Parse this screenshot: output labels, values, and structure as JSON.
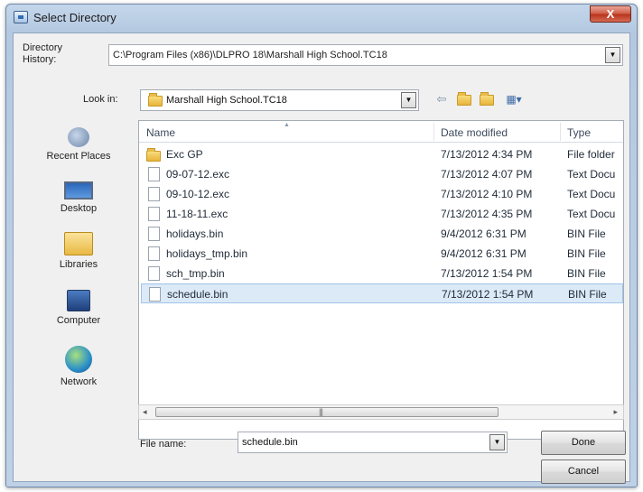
{
  "window": {
    "title": "Select Directory",
    "close_label": "X"
  },
  "history": {
    "label": "Directory History:",
    "value": "C:\\Program Files (x86)\\DLPRO 18\\Marshall High School.TC18"
  },
  "lookin": {
    "label": "Look in:",
    "value": "Marshall High School.TC18"
  },
  "toolbar": {
    "back_icon": "back-arrow-icon",
    "up_icon": "up-folder-icon",
    "new_folder_icon": "new-folder-icon",
    "views_icon": "views-menu-icon"
  },
  "places": [
    {
      "label": "Recent Places",
      "icon": "recent-places-icon"
    },
    {
      "label": "Desktop",
      "icon": "desktop-icon"
    },
    {
      "label": "Libraries",
      "icon": "libraries-icon"
    },
    {
      "label": "Computer",
      "icon": "computer-icon"
    },
    {
      "label": "Network",
      "icon": "network-icon"
    }
  ],
  "columns": {
    "name": "Name",
    "date": "Date modified",
    "type": "Type"
  },
  "files": [
    {
      "name": "Exc GP",
      "date": "7/13/2012 4:34 PM",
      "type": "File folder",
      "kind": "folder"
    },
    {
      "name": "09-07-12.exc",
      "date": "7/13/2012 4:07 PM",
      "type": "Text Docu",
      "kind": "file"
    },
    {
      "name": "09-10-12.exc",
      "date": "7/13/2012 4:10 PM",
      "type": "Text Docu",
      "kind": "file"
    },
    {
      "name": "11-18-11.exc",
      "date": "7/13/2012 4:35 PM",
      "type": "Text Docu",
      "kind": "file"
    },
    {
      "name": "holidays.bin",
      "date": "9/4/2012 6:31 PM",
      "type": "BIN File",
      "kind": "file"
    },
    {
      "name": "holidays_tmp.bin",
      "date": "9/4/2012 6:31 PM",
      "type": "BIN File",
      "kind": "file"
    },
    {
      "name": "sch_tmp.bin",
      "date": "7/13/2012 1:54 PM",
      "type": "BIN File",
      "kind": "file"
    },
    {
      "name": "schedule.bin",
      "date": "7/13/2012 1:54 PM",
      "type": "BIN File",
      "kind": "file",
      "selected": true
    }
  ],
  "filename": {
    "label": "File name:",
    "value": "schedule.bin"
  },
  "buttons": {
    "done": "Done",
    "cancel": "Cancel"
  }
}
